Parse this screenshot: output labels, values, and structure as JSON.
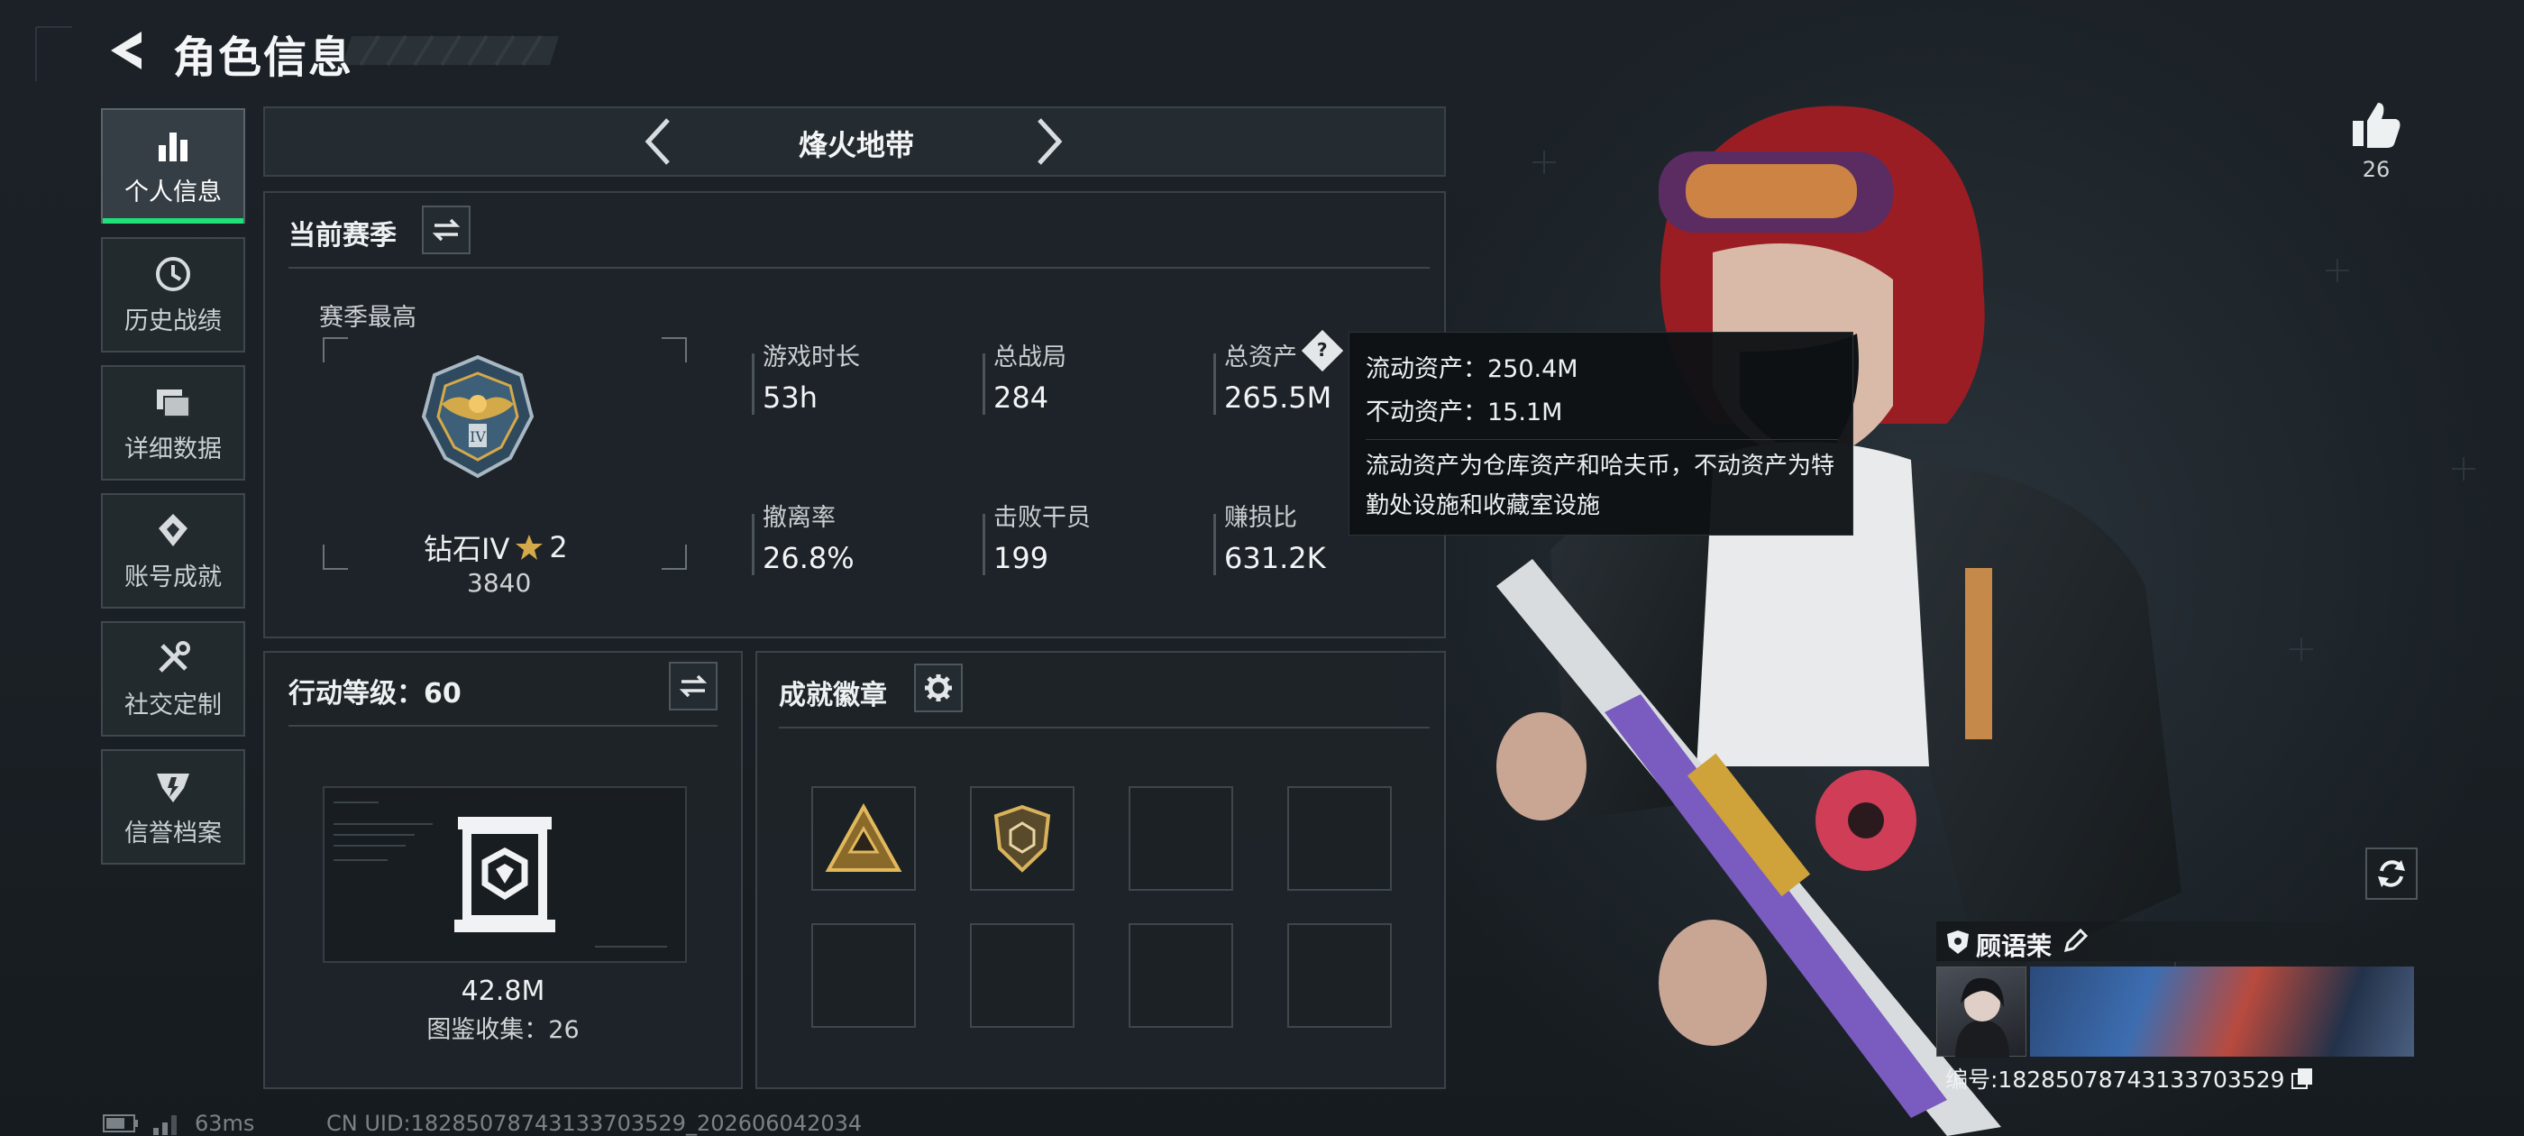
{
  "header": {
    "title": "角色信息"
  },
  "sidebar": {
    "items": [
      {
        "label": "个人信息",
        "icon": "bar-chart-icon",
        "active": true
      },
      {
        "label": "历史战绩",
        "icon": "history-clock-icon",
        "active": false
      },
      {
        "label": "详细数据",
        "icon": "folders-icon",
        "active": false
      },
      {
        "label": "账号成就",
        "icon": "achievement-icon",
        "active": false
      },
      {
        "label": "社交定制",
        "icon": "tools-icon",
        "active": false
      },
      {
        "label": "信誉档案",
        "icon": "reputation-icon",
        "active": false
      }
    ]
  },
  "mode_selector": {
    "label": "烽火地带"
  },
  "season": {
    "title": "当前赛季",
    "best_label": "赛季最高",
    "rank_name": "钻石IV",
    "rank_stars": "2",
    "rank_points": "3840",
    "stats": [
      {
        "label": "游戏时长",
        "value": "53h"
      },
      {
        "label": "总战局",
        "value": "284"
      },
      {
        "label": "总资产",
        "value": "265.5M"
      },
      {
        "label": "撤离率",
        "value": "26.8%"
      },
      {
        "label": "击败干员",
        "value": "199"
      },
      {
        "label": "赚损比",
        "value": "631.2K"
      }
    ]
  },
  "tooltip": {
    "liquid_label": "流动资产：",
    "liquid_value": "250.4M",
    "fixed_label": "不动资产：",
    "fixed_value": "15.1M",
    "description": "流动资产为仓库资产和哈夫币，不动资产为特勤处设施和收藏室设施"
  },
  "action_level": {
    "title": "行动等级：60",
    "collection_value": "42.8M",
    "collection_label": "图鉴收集：26"
  },
  "badges": {
    "title": "成就徽章",
    "slots": [
      {
        "icon": "triangle-badge-icon",
        "filled": true
      },
      {
        "icon": "shield-badge-icon",
        "filled": true
      },
      {
        "filled": false
      },
      {
        "filled": false
      },
      {
        "filled": false
      },
      {
        "filled": false
      },
      {
        "filled": false
      },
      {
        "filled": false
      }
    ]
  },
  "likes": {
    "count": "26"
  },
  "player_card": {
    "name": "顾语茉",
    "id_text": "编号:18285078743133703529"
  },
  "footer": {
    "ping": "63ms",
    "uid_text": "CN UID:18285078743133703529_202606042034"
  },
  "colors": {
    "accent_green": "#20e07a",
    "panel_bg": "#1e2429",
    "rank_gold": "#d4a94a"
  }
}
